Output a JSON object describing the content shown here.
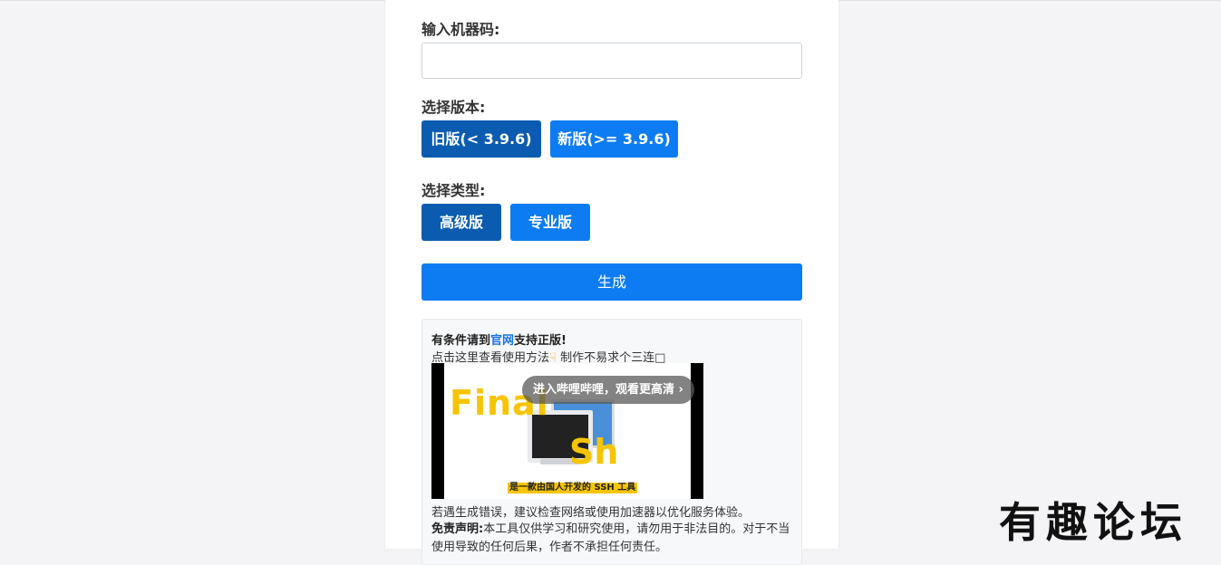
{
  "form": {
    "machine_code_label": "输入机器码:",
    "machine_code_value": "",
    "machine_code_placeholder": "",
    "version_label": "选择版本:",
    "version_old": "旧版(< 3.9.6)",
    "version_new": "新版(>= 3.9.6)",
    "type_label": "选择类型:",
    "type_advanced": "高级版",
    "type_pro": "专业版",
    "generate_label": "生成"
  },
  "notice": {
    "line1_prefix": "有条件请到",
    "line1_link": "官网",
    "line1_suffix": "支持正版!",
    "line2_text": "点击这里查看使用方法",
    "line2_icon": "pointing-down-hand",
    "line2_suffix": " 制作不易求个三连□",
    "line3": "若遇生成错误，建议检查网络或使用加速器以优化服务体验。",
    "disclaimer_label": "免责声明:",
    "disclaimer_text": "本工具仅供学习和研究使用，请勿用于非法目的。对于不当使用导致的任何后果，作者不承担任何责任。"
  },
  "video": {
    "overlay_button": "进入哔哩哔哩，观看更高清 ›",
    "title_part1": "Final",
    "title_part2": "Sh",
    "subtitle": "是一款由国人开发的 SSH 工具"
  },
  "watermark": "有趣论坛",
  "colors": {
    "primary": "#0d7cf2",
    "primary_dark": "#0b5cb0",
    "accent_yellow": "#f6c400"
  }
}
